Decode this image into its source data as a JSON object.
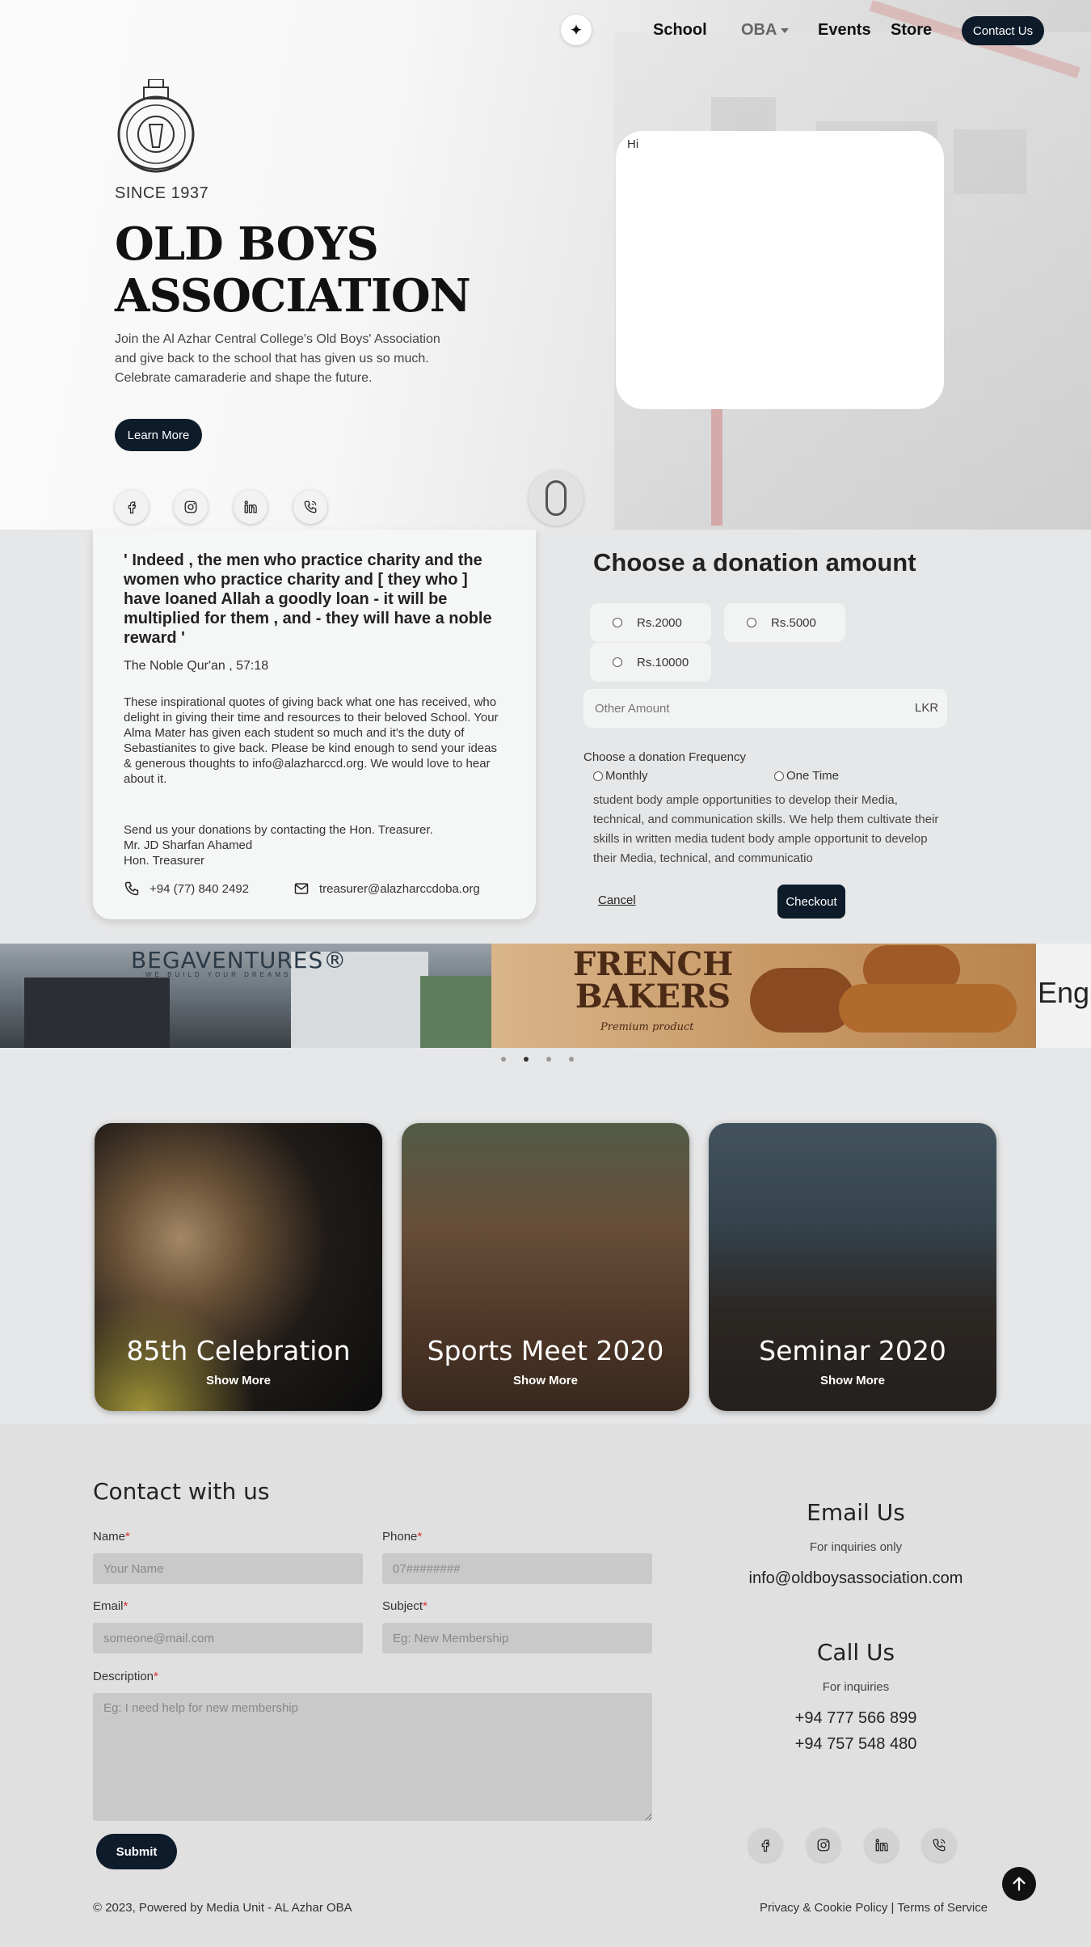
{
  "nav": {
    "theme_icon": "sparkle-icon",
    "links": [
      {
        "label": "School"
      },
      {
        "label": "OBA"
      },
      {
        "label": "Events"
      },
      {
        "label": "Store"
      }
    ],
    "contact_label": "Contact Us"
  },
  "hero": {
    "since": "SINCE 1937",
    "title": "OLD BOYS ASSOCIATION",
    "description": "Join the Al Azhar Central College's Old Boys' Association and give back to the school that has given us so much. Celebrate camaraderie and shape the future.",
    "learn_more": "Learn More",
    "box_text": "Hi",
    "social_icons": [
      "facebook-icon",
      "instagram-icon",
      "linkedin-icon",
      "phone-icon"
    ]
  },
  "quote": {
    "text": "' Indeed , the men who practice charity and the women who practice charity and [ they who ] have loaned Allah a goodly loan - it will be multiplied for them , and - they will have a noble reward '",
    "source": "The Noble Qur'an , 57:18",
    "body": "These inspirational quotes of giving back what one has received, who delight in giving their time and resources to their beloved School. Your Alma Mater has given each student so much and it's the duty of Sebastianites to give back. Please be kind enough to send your ideas & generous thoughts to info@alazharccd.org. We would love to hear about it.",
    "send_line1": "Send us your donations by contacting the Hon. Treasurer.",
    "send_line2": "Mr. JD Sharfan Ahamed",
    "send_line3": "Hon. Treasurer",
    "phone": "+94 (77) 840 2492",
    "email": "treasurer@alazharccdoba.org"
  },
  "donation": {
    "title": "Choose a donation amount",
    "amounts": [
      "Rs.2000",
      "Rs.5000",
      "Rs.10000"
    ],
    "other_placeholder": "Other Amount",
    "currency": "LKR",
    "frequency_label": "Choose a donation Frequency",
    "frequencies": [
      "Monthly",
      "One Time"
    ],
    "text": "student body ample opportunities to develop their Media, technical, and communication skills. We help them cultivate their skills in written media tudent body ample opportunit to develop their Media, technical, and communicatio",
    "cancel": "Cancel",
    "checkout": "Checkout"
  },
  "sponsors": {
    "items": [
      "BEGAVENTURES®",
      "WE BUILD YOUR DREAMS",
      "FRENCH BAKERS",
      "Premium product",
      "Eng"
    ],
    "active_dot": 1
  },
  "events": [
    {
      "title": "85th Celebration",
      "more": "Show More"
    },
    {
      "title": "Sports Meet 2020",
      "more": "Show More"
    },
    {
      "title": "Seminar 2020",
      "more": "Show More"
    }
  ],
  "contact_form": {
    "title": "Contact with us",
    "name_label": "Name",
    "name_placeholder": "Your Name",
    "phone_label": "Phone",
    "phone_placeholder": "07########",
    "email_label": "Email",
    "email_placeholder": "someone@mail.com",
    "subject_label": "Subject",
    "subject_placeholder": "Eg: New Membership",
    "description_label": "Description",
    "description_placeholder": "Eg: I need help for new membership",
    "required_mark": "*",
    "submit": "Submit"
  },
  "contact_info": {
    "email_title": "Email Us",
    "email_sub": "For inquiries only",
    "email": "info@oldboysassociation.com",
    "call_title": "Call Us",
    "call_sub": "For inquiries",
    "phone1": "+94 777 566 899",
    "phone2": "+94 757 548 480"
  },
  "footer": {
    "copyright": "© 2023, Powered by Media Unit - AL Azhar OBA",
    "legal": "Privacy & Cookie Policy | Terms of Service"
  },
  "colors": {
    "primary": "#0d1b2a",
    "required": "#d32f2f"
  }
}
